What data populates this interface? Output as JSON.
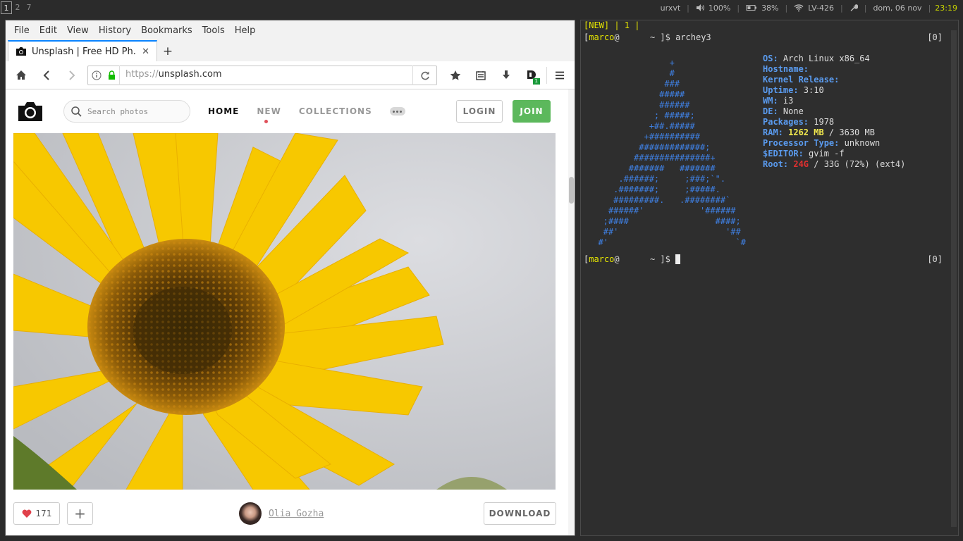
{
  "statusbar": {
    "workspaces": [
      "1",
      "2",
      "7"
    ],
    "active_workspace": "1",
    "window": "urxvt",
    "volume": "100%",
    "battery": "38%",
    "wifi": "LV-426",
    "date": "dom, 06 nov",
    "time": "23:19",
    "time_color": "#c8d400"
  },
  "browser": {
    "menu": [
      "File",
      "Edit",
      "View",
      "History",
      "Bookmarks",
      "Tools",
      "Help"
    ],
    "tab_title": "Unsplash | Free HD Ph...",
    "url_scheme": "https://",
    "url_host": "unsplash.com",
    "badge": "1",
    "accent": "#0a84ff"
  },
  "page": {
    "search_placeholder": "Search photos",
    "nav": [
      "HOME",
      "NEW",
      "COLLECTIONS"
    ],
    "login": "LOGIN",
    "join": "JOIN",
    "join_color": "#5cb85c",
    "likes": "171",
    "author": "Olia Gozha",
    "download": "DOWNLOAD"
  },
  "terminal": {
    "tabbar": "[NEW] | 1 |",
    "prompt_open": "[",
    "prompt_user": "marco",
    "prompt_at": "@",
    "prompt_rest": "      ~ ]$ ",
    "command": "archey3",
    "counter": "[0]",
    "art": "                +\n                #\n               ###\n              #####\n              ######\n             ; #####;\n            +##.#####\n           +##########\n          #############;\n         ###############+\n        #######   #######\n      .######;     ;###;`\".\n     .#######;     ;#####.\n     #########.   .########`\n    ######'           '######\n   ;####                 ####;\n   ##'                     '##\n  #'                         `#",
    "info": [
      {
        "k": "OS:",
        "v": " Arch Linux x86_64"
      },
      {
        "k": "Hostname:",
        "v": ""
      },
      {
        "k": "Kernel Release:",
        "v": ""
      },
      {
        "k": "Uptime:",
        "v": " 3:10"
      },
      {
        "k": "WM:",
        "v": " i3"
      },
      {
        "k": "DE:",
        "v": " None"
      },
      {
        "k": "Packages:",
        "v": " 1978"
      },
      {
        "k": "RAM:",
        "hl": " 1262 MB",
        "v": " / 3630 MB"
      },
      {
        "k": "Processor Type:",
        "v": " unknown"
      },
      {
        "k": "$EDITOR:",
        "v": " gvim -f"
      },
      {
        "k": "Root:",
        "hl": " 24G",
        "v": " / 33G (72%) (ext4)"
      }
    ],
    "prompt2_counter": "[0]"
  }
}
